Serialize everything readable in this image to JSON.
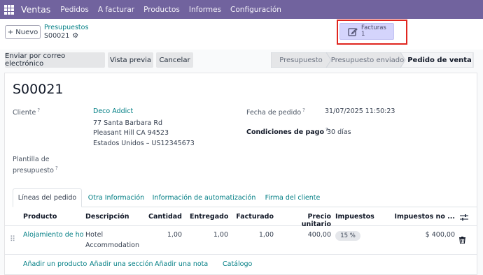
{
  "topbar": {
    "brand": "Ventas",
    "menu": [
      "Pedidos",
      "A facturar",
      "Productos",
      "Informes",
      "Configuración"
    ]
  },
  "control": {
    "new_label": "+ Nuevo",
    "breadcrumb_parent": "Presupuestos",
    "breadcrumb_current": "S00021",
    "smart_button": {
      "label": "Facturas",
      "count": "1"
    }
  },
  "actions": {
    "email": "Enviar por correo electrónico",
    "preview": "Vista previa",
    "cancel": "Cancelar"
  },
  "statusbar": {
    "steps": [
      "Presupuesto",
      "Presupuesto enviado",
      "Pedido de venta"
    ],
    "active": "Pedido de venta"
  },
  "form": {
    "title": "S00021",
    "customer_label": "Cliente",
    "customer_name": "Deco Addict",
    "address_line1": "77 Santa Barbara Rd",
    "address_line2": "Pleasant Hill CA 94523",
    "address_line3": "Estados Unidos – US12345673",
    "template_label_1": "Plantilla de",
    "template_label_2": "presupuesto",
    "order_date_label": "Fecha de pedido",
    "order_date": "31/07/2025 11:50:23",
    "payment_terms_label": "Condiciones de pago",
    "payment_terms": "30 días",
    "tooltip_mark": "?"
  },
  "tabs": [
    "Líneas del pedido",
    "Otra Información",
    "Información de automatización",
    "Firma del cliente"
  ],
  "table": {
    "headers": {
      "product": "Producto",
      "description": "Descripción",
      "quantity": "Cantidad",
      "delivered": "Entregado",
      "invoiced": "Facturado",
      "unit_price": "Precio unitario",
      "taxes": "Impuestos",
      "taxes_total": "Impuestos no ..."
    },
    "rows": [
      {
        "product": "Alojamiento de hote",
        "description_1": "Hotel",
        "description_2": "Accommodation",
        "quantity": "1,00",
        "delivered": "1,00",
        "invoiced": "1,00",
        "unit_price": "400,00",
        "tax": "15 %",
        "subtotal": "$ 400,00"
      }
    ]
  },
  "footer_links": [
    "Añadir un producto",
    "Añadir una sección",
    "Añadir una nota",
    "Catálogo"
  ]
}
